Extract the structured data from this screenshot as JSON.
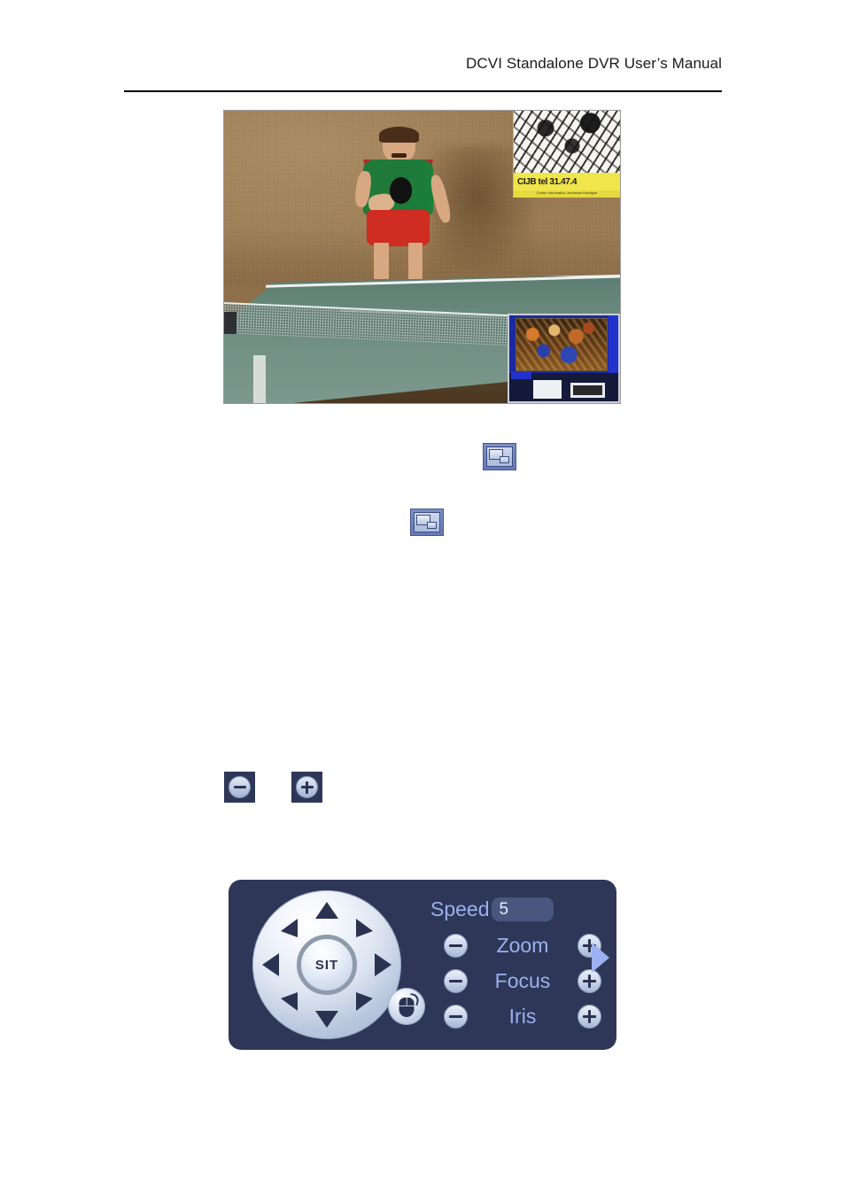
{
  "header": {
    "title": "DCVI Standalone DVR User’s Manual"
  },
  "figure_video": {
    "name": "live-preview-with-picture-in-picture",
    "scene_description": "Table tennis player in green shirt and red shorts standing behind a table tennis table",
    "poster": {
      "band_text": "CIJB tel 31.47.4",
      "band_subtext": "Centre Information Jeunesse Bretagne"
    },
    "pip_inset": {
      "label": "picture-in-picture-inset",
      "description": "Secondary channel showing an indoor crowd scene"
    }
  },
  "icons": {
    "pip_layout_icon_1": "pip-layout-icon",
    "pip_layout_icon_2": "pip-layout-icon",
    "minus_icon": "minus-icon",
    "plus_icon": "plus-icon"
  },
  "ptz_panel": {
    "name": "ptz-control-panel",
    "direction_pad": {
      "center_label": "SIT",
      "directions": [
        "up",
        "up-right",
        "right",
        "down-right",
        "down",
        "down-left",
        "left",
        "up-left"
      ]
    },
    "mouse_button": "mouse-icon",
    "speed": {
      "label": "Speed",
      "value": "5"
    },
    "controls": [
      {
        "label": "Zoom",
        "minus": "−",
        "plus": "+"
      },
      {
        "label": "Focus",
        "minus": "−",
        "plus": "+"
      },
      {
        "label": "Iris",
        "minus": "−",
        "plus": "+"
      }
    ],
    "expand_arrow": "chevron-right-icon"
  },
  "colors": {
    "panel_background": "#2e3757",
    "label_text": "#9db0ef",
    "field_background": "#4a5680",
    "button_face": "#cdd8ec",
    "glyph_dark": "#2b3352",
    "page_background": "#ffffff",
    "rule": "#000000"
  }
}
